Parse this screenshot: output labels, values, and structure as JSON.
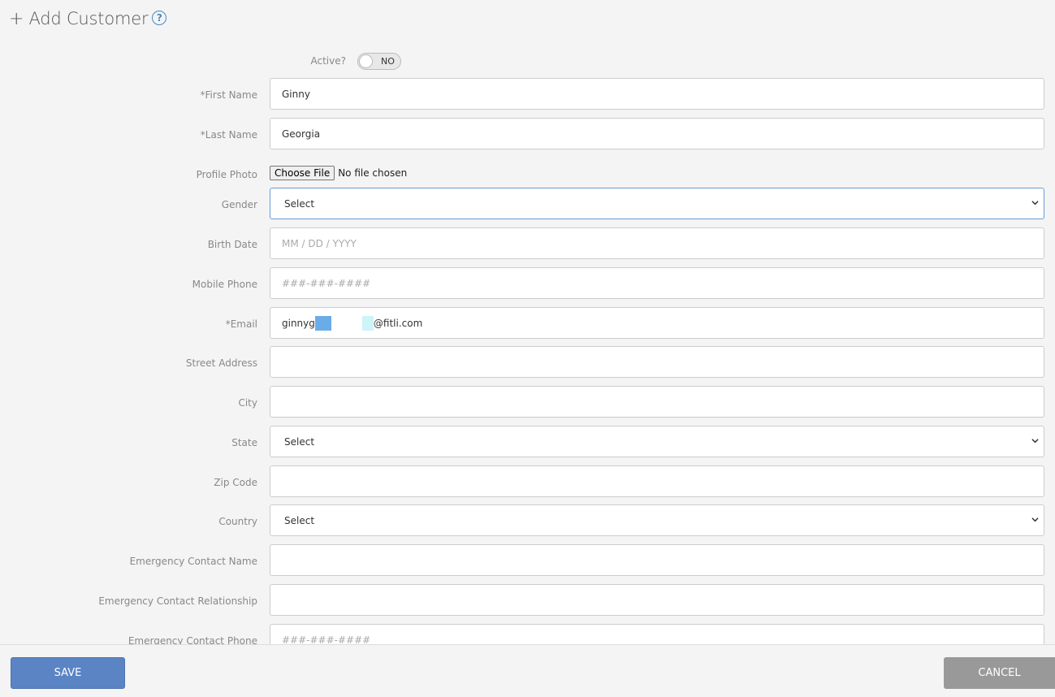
{
  "header": {
    "plus": "+",
    "title": "Add Customer",
    "help": "?"
  },
  "active": {
    "label": "Active?",
    "value": "NO"
  },
  "fields": {
    "first_name": {
      "label": "*First Name",
      "value": "Ginny"
    },
    "last_name": {
      "label": "*Last Name",
      "value": "Georgia"
    },
    "profile_photo": {
      "label": "Profile Photo",
      "button": "Choose File",
      "status": "No file chosen"
    },
    "gender": {
      "label": "Gender",
      "value": "Select"
    },
    "birth_date": {
      "label": "Birth Date",
      "placeholder": "MM / DD / YYYY"
    },
    "mobile_phone": {
      "label": "Mobile Phone",
      "placeholder": "###-###-####"
    },
    "email": {
      "label": "*Email",
      "prefix": "ginnyg",
      "suffix": "@fitli.com"
    },
    "street_address": {
      "label": "Street Address",
      "value": ""
    },
    "city": {
      "label": "City",
      "value": ""
    },
    "state": {
      "label": "State",
      "value": "Select"
    },
    "zip_code": {
      "label": "Zip Code",
      "value": ""
    },
    "country": {
      "label": "Country",
      "value": "Select"
    },
    "emergency_name": {
      "label": "Emergency Contact Name",
      "value": ""
    },
    "emergency_relationship": {
      "label": "Emergency Contact Relationship",
      "value": ""
    },
    "emergency_phone": {
      "label": "Emergency Contact Phone",
      "placeholder": "###-###-####"
    }
  },
  "footer": {
    "save": "SAVE",
    "cancel": "CANCEL"
  },
  "colors": {
    "accent": "#5a84c4",
    "help": "#4a86c7",
    "cancel": "#999999"
  }
}
